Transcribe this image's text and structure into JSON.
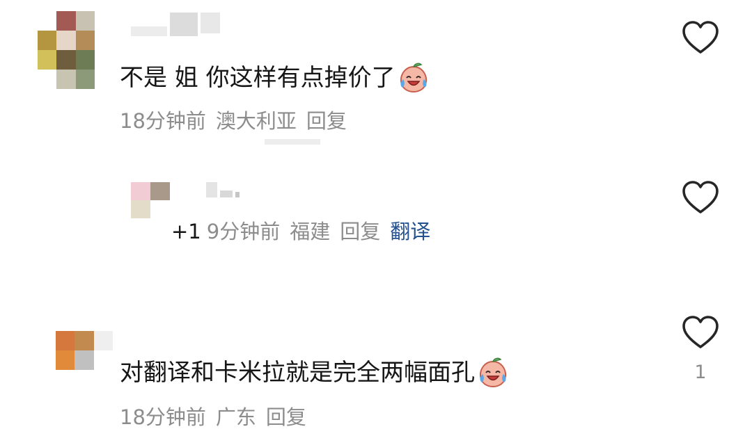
{
  "comments": [
    {
      "text": "不是 姐 你这样有点掉价了",
      "emoji": "crying-laughing-peach-emoji",
      "time": "18分钟前",
      "location": "澳大利亚",
      "reply_label": "回复",
      "like_icon": "heart-outline-icon",
      "like_count": ""
    },
    {
      "text": "",
      "prefix": "+1",
      "time": "9分钟前",
      "location": "福建",
      "reply_label": "回复",
      "translate_label": "翻译",
      "like_icon": "heart-outline-icon",
      "like_count": ""
    },
    {
      "text": "对翻译和卡米拉就是完全两幅面孔",
      "emoji": "crying-laughing-peach-emoji",
      "time": "18分钟前",
      "location": "广东",
      "reply_label": "回复",
      "like_icon": "heart-outline-icon",
      "like_count": "1"
    }
  ],
  "colors": {
    "text": "#161616",
    "meta": "#8c8c8c",
    "translate_link": "#23508e"
  }
}
